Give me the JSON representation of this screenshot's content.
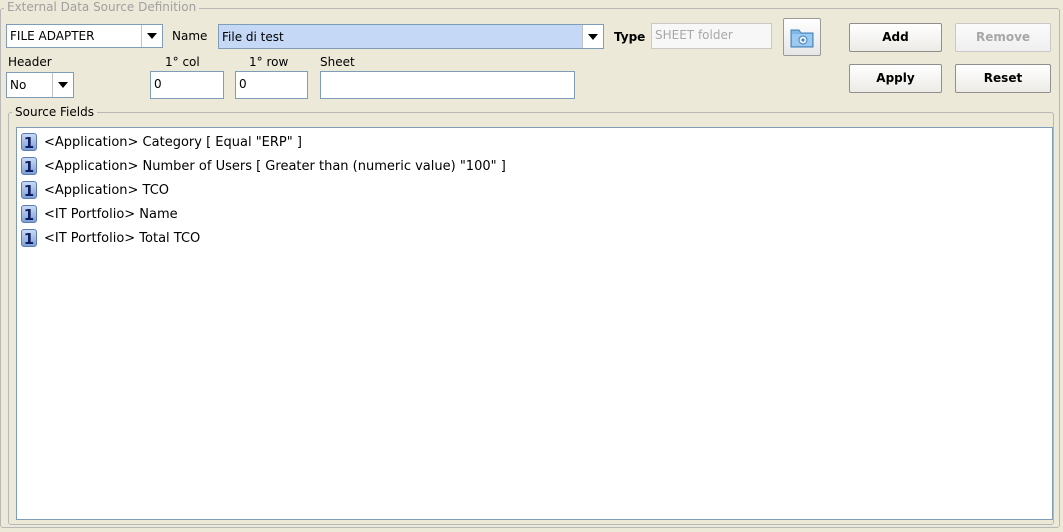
{
  "group_title": "External Data Source Definition",
  "adapter": {
    "value": "FILE ADAPTER"
  },
  "name": {
    "label": "Name",
    "value": "File di test"
  },
  "type": {
    "label": "Type",
    "value": "SHEET folder"
  },
  "folder_icon": "folder-gear-icon",
  "buttons": {
    "add": "Add",
    "remove": "Remove",
    "apply": "Apply",
    "reset": "Reset"
  },
  "header": {
    "label": "Header",
    "value": "No"
  },
  "first_col": {
    "label": "1° col",
    "value": "0"
  },
  "first_row": {
    "label": "1° row",
    "value": "0"
  },
  "sheet": {
    "label": "Sheet",
    "value": ""
  },
  "source_fields": {
    "title": "Source Fields",
    "items": [
      {
        "badge": "1",
        "text": "<Application> Category   [ Equal \"ERP\" ]"
      },
      {
        "badge": "1",
        "text": "<Application> Number of Users   [ Greater than  (numeric value) \"100\" ]"
      },
      {
        "badge": "1",
        "text": "<Application> TCO"
      },
      {
        "badge": "1",
        "text": "<IT Portfolio> Name"
      },
      {
        "badge": "1",
        "text": "<IT Portfolio> Total TCO"
      }
    ]
  }
}
